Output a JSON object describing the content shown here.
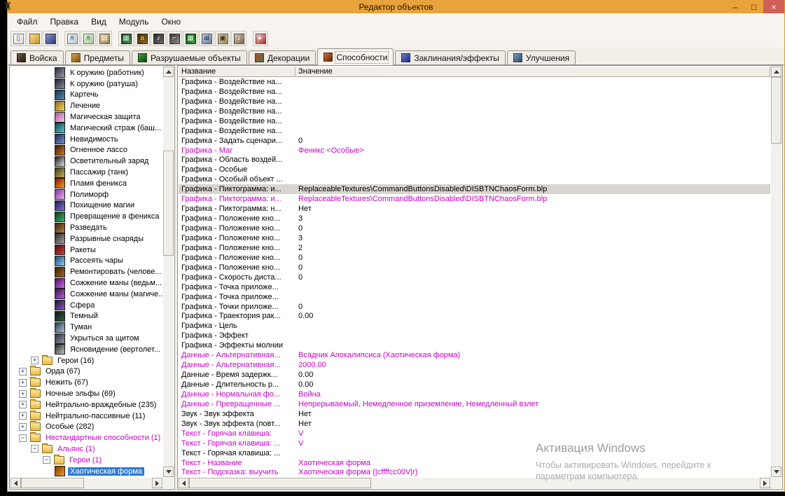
{
  "window": {
    "title": "Редактор объектов",
    "app_icon_glyph": "♜",
    "controls": {
      "minimize": "–",
      "maximize": "□",
      "close": "×"
    }
  },
  "menu": {
    "items": [
      {
        "name": "file",
        "label": "Файл"
      },
      {
        "name": "edit",
        "label": "Правка"
      },
      {
        "name": "view",
        "label": "Вид"
      },
      {
        "name": "module",
        "label": "Модуль"
      },
      {
        "name": "window",
        "label": "Окно"
      }
    ]
  },
  "toolbar": {
    "items": [
      {
        "name": "new-map",
        "c1": "#ffffff",
        "c2": "#d8d8d8",
        "fg": "#555555",
        "glyph": "▯"
      },
      {
        "name": "open-map",
        "c1": "#f7d98a",
        "c2": "#c89a2a",
        "fg": "#6a4a00",
        "glyph": ""
      },
      {
        "name": "save-map",
        "c1": "#8a94c8",
        "c2": "#2a3a7a",
        "fg": "#ffffff",
        "glyph": ""
      },
      {
        "sep": true
      },
      {
        "name": "copy",
        "c1": "#f0f0f0",
        "c2": "#b8c8e0",
        "fg": "#334455",
        "glyph": "≡"
      },
      {
        "name": "copy-object",
        "c1": "#e8f0e0",
        "c2": "#a8c8a0",
        "fg": "#225533",
        "glyph": "≡"
      },
      {
        "name": "paste",
        "c1": "#d8c8a0",
        "c2": "#a08050",
        "fg": "#ffffff",
        "glyph": "▤"
      },
      {
        "sep": true
      },
      {
        "name": "terrain-editor",
        "c1": "#1a3a1a",
        "c2": "#4a8a4a",
        "fg": "#cceeee",
        "glyph": "▦"
      },
      {
        "name": "trigger-editor",
        "c1": "#3a2a10",
        "c2": "#8a6a20",
        "fg": "#ffd700",
        "glyph": "a"
      },
      {
        "name": "sound-editor",
        "c1": "#2a2a2a",
        "c2": "#6a6a6a",
        "fg": "#ffffff",
        "glyph": "♪"
      },
      {
        "name": "object-editor",
        "c1": "#3a3a3a",
        "c2": "#8a8a8a",
        "fg": "#ffffdd",
        "glyph": "⌐"
      },
      {
        "name": "campaign-editor",
        "c1": "#0a4a0a",
        "c2": "#3a9a3a",
        "fg": "#ddffdd",
        "glyph": "▦"
      },
      {
        "name": "ai-editor",
        "c1": "#c8d0e0",
        "c2": "#6a7a9a",
        "fg": "#112233",
        "glyph": "ai"
      },
      {
        "name": "object-manager",
        "c1": "#e0d8c0",
        "c2": "#9a8a5a",
        "fg": "#443322",
        "glyph": "▣"
      },
      {
        "name": "import-manager",
        "c1": "#d0c8b8",
        "c2": "#7a6a4a",
        "fg": "#ffffff",
        "glyph": "↓"
      },
      {
        "sep": true
      },
      {
        "name": "test-map",
        "c1": "#e8d0d0",
        "c2": "#a83030",
        "fg": "#ffffff",
        "glyph": "▸"
      }
    ]
  },
  "tabs": [
    {
      "name": "troops",
      "label": "Войска",
      "c1": "#6a5a4a",
      "c2": "#2a1a0a"
    },
    {
      "name": "items",
      "label": "Предметы",
      "c1": "#d8a850",
      "c2": "#7a4a10"
    },
    {
      "name": "destructibles",
      "label": "Разрушаемые объекты",
      "c1": "#4a9a4a",
      "c2": "#0a4a0a"
    },
    {
      "name": "doodads",
      "label": "Декорации",
      "c1": "#a84a3a",
      "c2": "#4a7a3a"
    },
    {
      "name": "abilities",
      "label": "Способности",
      "active": true,
      "c1": "#c87a3a",
      "c2": "#6a1a0a"
    },
    {
      "name": "spells-effects",
      "label": "Заклинания/эффекты",
      "c1": "#6a7ad8",
      "c2": "#1a2a7a"
    },
    {
      "name": "upgrades",
      "label": "Улучшения",
      "c1": "#7a9ab8",
      "c2": "#2a4a6a"
    }
  ],
  "tree": {
    "items": [
      {
        "label": "К оружию (работник)",
        "lvl": 4,
        "type": "leaf",
        "icon": [
          "#2b2b3a",
          "#9a9ab0"
        ]
      },
      {
        "label": "К оружию (ратуша)",
        "lvl": 4,
        "type": "leaf",
        "icon": [
          "#1f1f2e",
          "#8a8aa0"
        ]
      },
      {
        "label": "Картечь",
        "lvl": 4,
        "type": "leaf",
        "icon": [
          "#16324a",
          "#5a8ab0"
        ]
      },
      {
        "label": "Лечение",
        "lvl": 4,
        "type": "leaf",
        "icon": [
          "#8a6a10",
          "#f0d860"
        ]
      },
      {
        "label": "Магическая защита",
        "lvl": 4,
        "type": "leaf",
        "icon": [
          "#b05a9a",
          "#f0c8e8"
        ]
      },
      {
        "label": "Магический страж (баш...",
        "lvl": 4,
        "type": "leaf",
        "icon": [
          "#0a4a50",
          "#60c0c8"
        ]
      },
      {
        "label": "Невидимость",
        "lvl": 4,
        "type": "leaf",
        "icon": [
          "#1a2a50",
          "#7090d0"
        ]
      },
      {
        "label": "Огненное лассо",
        "lvl": 4,
        "type": "leaf",
        "icon": [
          "#3a1a0a",
          "#d07820"
        ]
      },
      {
        "label": "Осветительный заряд",
        "lvl": 4,
        "type": "leaf",
        "icon": [
          "#1a1a1a",
          "#e0e0e0"
        ]
      },
      {
        "label": "Пассажир (танк)",
        "lvl": 4,
        "type": "leaf",
        "icon": [
          "#3a3a20",
          "#c0b050"
        ]
      },
      {
        "label": "Пламя феникса",
        "lvl": 4,
        "type": "leaf",
        "icon": [
          "#8a1000",
          "#f0a020"
        ]
      },
      {
        "label": "Полиморф",
        "lvl": 4,
        "type": "leaf",
        "icon": [
          "#8a30a0",
          "#e8b0e8"
        ]
      },
      {
        "label": "Похищение магии",
        "lvl": 4,
        "type": "leaf",
        "icon": [
          "#201a50",
          "#8070d8"
        ]
      },
      {
        "label": "Превращение в феникса",
        "lvl": 4,
        "type": "leaf",
        "icon": [
          "#0a3a20",
          "#40b060"
        ]
      },
      {
        "label": "Разведать",
        "lvl": 4,
        "type": "leaf",
        "icon": [
          "#3a2410",
          "#b08040"
        ]
      },
      {
        "label": "Разрывные снаряды",
        "lvl": 4,
        "type": "leaf",
        "icon": [
          "#2a2a2a",
          "#a0a0a0"
        ]
      },
      {
        "label": "Ракеты",
        "lvl": 4,
        "type": "leaf",
        "icon": [
          "#500a0a",
          "#d04040"
        ]
      },
      {
        "label": "Рассеять чары",
        "lvl": 4,
        "type": "leaf",
        "icon": [
          "#1a4a70",
          "#90c8f0"
        ]
      },
      {
        "label": "Ремонтировать (челове...",
        "lvl": 4,
        "type": "leaf",
        "icon": [
          "#3a2000",
          "#a06830"
        ]
      },
      {
        "label": "Сожжение маны (ведьм...",
        "lvl": 4,
        "type": "leaf",
        "icon": [
          "#500a70",
          "#c070e0"
        ]
      },
      {
        "label": "Сожжение маны (магиче...",
        "lvl": 4,
        "type": "leaf",
        "icon": [
          "#40105a",
          "#b060d0"
        ]
      },
      {
        "label": "Сфера",
        "lvl": 4,
        "type": "leaf",
        "icon": [
          "#20103a",
          "#8a60b8"
        ]
      },
      {
        "label": "Темный",
        "lvl": 4,
        "type": "leaf",
        "icon": [
          "#0a1a10",
          "#305a40"
        ]
      },
      {
        "label": "Туман",
        "lvl": 4,
        "type": "leaf",
        "icon": [
          "#2a3a50",
          "#a8c0d8"
        ]
      },
      {
        "label": "Укрыться за щитом",
        "lvl": 4,
        "type": "leaf",
        "icon": [
          "#32343a",
          "#8a94a8"
        ]
      },
      {
        "label": "Ясновидение (вертолет...",
        "lvl": 4,
        "type": "leaf",
        "icon": [
          "#2a2a2a",
          "#c0c0c0"
        ]
      },
      {
        "label": "Герои (16)",
        "lvl": 2,
        "type": "node",
        "exp": "+",
        "icon": "folder"
      },
      {
        "label": "Орда (67)",
        "lvl": 1,
        "type": "node",
        "exp": "+",
        "icon": "folder"
      },
      {
        "label": "Нежить (67)",
        "lvl": 1,
        "type": "node",
        "exp": "+",
        "icon": "folder"
      },
      {
        "label": "Ночные эльфы (69)",
        "lvl": 1,
        "type": "node",
        "exp": "+",
        "icon": "folder"
      },
      {
        "label": "Нейтрально-враждебные (235)",
        "lvl": 1,
        "type": "node",
        "exp": "+",
        "icon": "folder"
      },
      {
        "label": "Нейтрально-пассивные (11)",
        "lvl": 1,
        "type": "node",
        "exp": "+",
        "icon": "folder"
      },
      {
        "label": "Особые (282)",
        "lvl": 1,
        "type": "node",
        "exp": "+",
        "icon": "folder"
      },
      {
        "label": "Нестандартные способности (1)",
        "lvl": 1,
        "type": "node",
        "exp": "−",
        "icon": "folder",
        "color": "m"
      },
      {
        "label": "Альянс (1)",
        "lvl": 2,
        "type": "node",
        "exp": "−",
        "icon": "folder",
        "color": "m"
      },
      {
        "label": "Герои (1)",
        "lvl": 3,
        "type": "node",
        "exp": "−",
        "icon": "folder",
        "color": "m"
      },
      {
        "label": "Хаотическая форма",
        "lvl": 4,
        "type": "leaf",
        "icon": [
          "#8a3a00",
          "#e89a2a"
        ],
        "sel": true
      }
    ]
  },
  "table": {
    "columns": [
      "Название",
      "Значение"
    ],
    "rows": [
      {
        "n": "Графика - Воздействие на...",
        "v": ""
      },
      {
        "n": "Графика - Воздействие на...",
        "v": ""
      },
      {
        "n": "Графика - Воздействие на...",
        "v": ""
      },
      {
        "n": "Графика - Воздействие на...",
        "v": ""
      },
      {
        "n": "Графика - Воздействие на...",
        "v": ""
      },
      {
        "n": "Графика - Воздействие на...",
        "v": ""
      },
      {
        "n": "Графика - Задать сценари...",
        "v": "0"
      },
      {
        "n": "Графика - Маг",
        "v": "Феникс <Особые>",
        "c": "m"
      },
      {
        "n": "Графика - Область воздей...",
        "v": ""
      },
      {
        "n": "Графика - Особые",
        "v": ""
      },
      {
        "n": "Графика - Особый объект ...",
        "v": ""
      },
      {
        "n": "Графика - Пиктограмма: и...",
        "v": "ReplaceableTextures\\CommandButtonsDisabled\\DISBTNChaosForm.blp",
        "sel": true
      },
      {
        "n": "Графика - Пиктограмма: и...",
        "v": "ReplaceableTextures\\CommandButtonsDisabled\\DISBTNChaosForm.blp",
        "c": "m"
      },
      {
        "n": "Графика - Пиктограмма: н...",
        "v": "Нет"
      },
      {
        "n": "Графика - Положение кно...",
        "v": "3"
      },
      {
        "n": "Графика - Положение кно...",
        "v": "0"
      },
      {
        "n": "Графика - Положение кно...",
        "v": "3"
      },
      {
        "n": "Графика - Положение кно...",
        "v": "2"
      },
      {
        "n": "Графика - Положение кно...",
        "v": "0"
      },
      {
        "n": "Графика - Положение кно...",
        "v": "0"
      },
      {
        "n": "Графика - Скорость диста...",
        "v": "0"
      },
      {
        "n": "Графика - Точка приложе...",
        "v": ""
      },
      {
        "n": "Графика - Точка приложе...",
        "v": ""
      },
      {
        "n": "Графика - Точки приложе...",
        "v": "0"
      },
      {
        "n": "Графика - Траектория рак...",
        "v": "0.00"
      },
      {
        "n": "Графика - Цель",
        "v": ""
      },
      {
        "n": "Графика - Эффект",
        "v": ""
      },
      {
        "n": "Графика - Эффекты молнии",
        "v": ""
      },
      {
        "n": "Данные - Альтернативная...",
        "v": "Всадник Апокалипсиса (Хаотическая форма)",
        "c": "m"
      },
      {
        "n": "Данные - Альтернативная...",
        "v": "2000.00",
        "c": "m"
      },
      {
        "n": "Данные - Время задержк...",
        "v": "0.00"
      },
      {
        "n": "Данные - Длительность р...",
        "v": "0.00"
      },
      {
        "n": "Данные - Нормальная фо...",
        "v": "Война",
        "c": "m"
      },
      {
        "n": "Данные - Превращенные ...",
        "v": "Непрерываемый, Немедленное приземление, Немедленный взлет",
        "c": "m"
      },
      {
        "n": "Звук - Звук эффекта",
        "v": "Нет"
      },
      {
        "n": "Звук - Звук эффекта (повт...",
        "v": "Нет"
      },
      {
        "n": "Текст - Горячая клавиша: ",
        "v": "V",
        "c": "m"
      },
      {
        "n": "Текст - Горячая клавиша: ...",
        "v": "V",
        "c": "m"
      },
      {
        "n": "Текст - Горячая клавиша: ...",
        "v": ""
      },
      {
        "n": "Текст - Название",
        "v": "Хаотическая форма",
        "c": "m"
      },
      {
        "n": "Текст - Подсказка: выучить",
        "v": "Хаотическая форма (|cffffcc00V|r)",
        "c": "m"
      }
    ]
  },
  "watermark": {
    "title": "Активация Windows",
    "line1": "Чтобы активировать Windows, перейдите к",
    "line2": "параметрам компьютера."
  },
  "colors": {
    "titlebar": "#e8a33c",
    "magenta": "#c800c8",
    "selection_blue": "#2e7ad2",
    "selection_gray": "#d8d5cf"
  }
}
